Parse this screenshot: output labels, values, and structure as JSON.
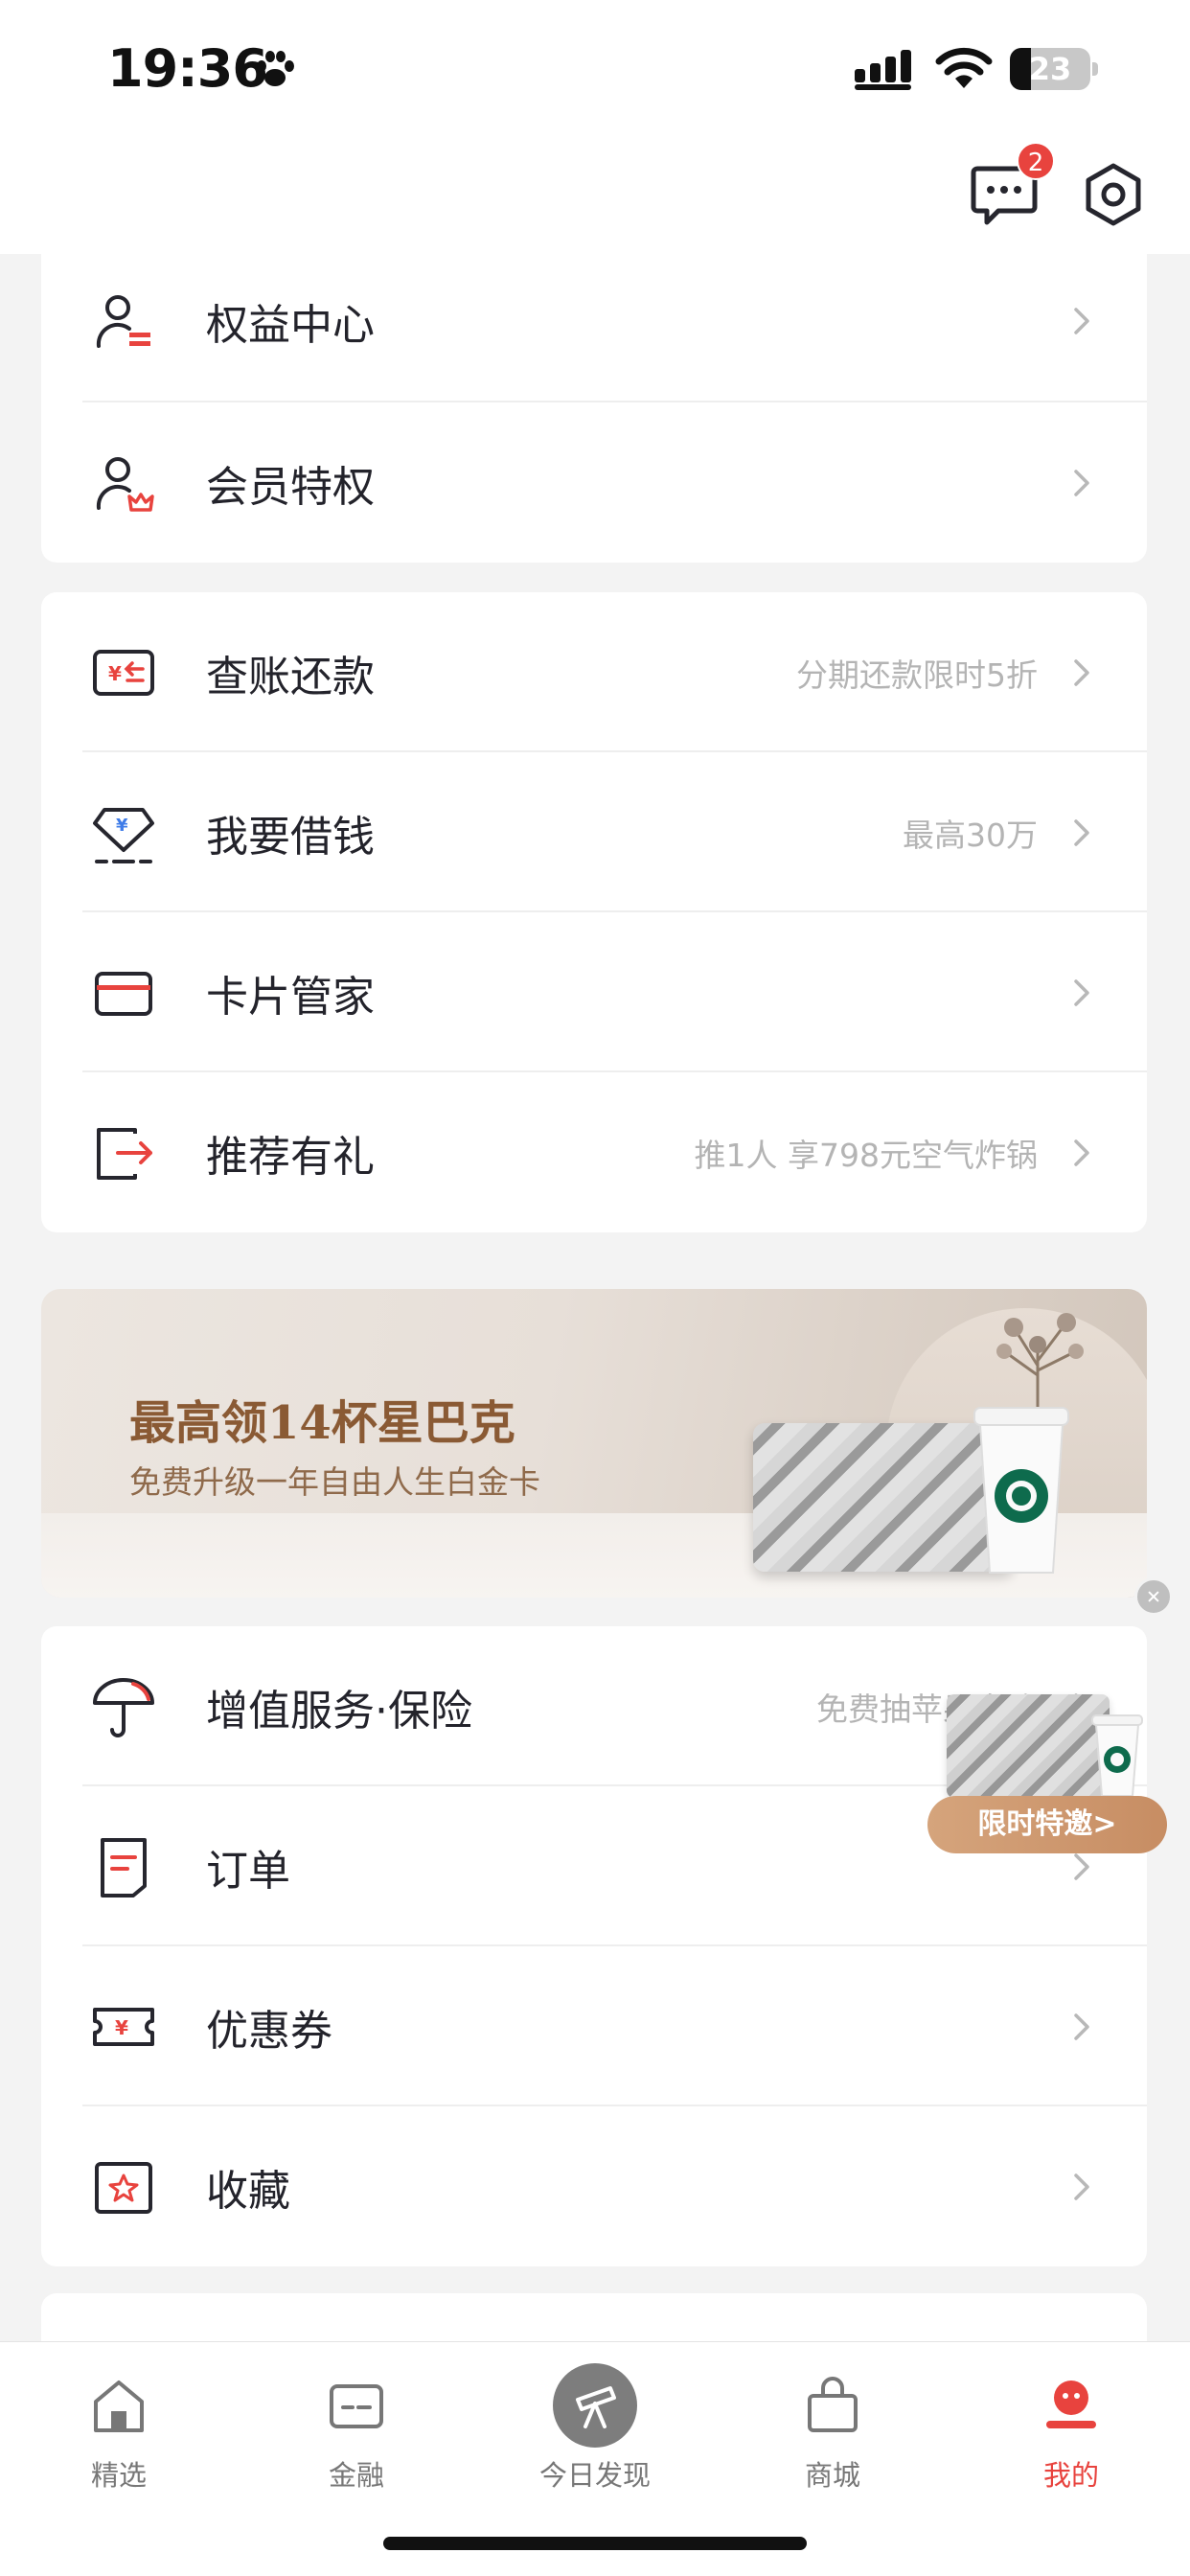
{
  "status_bar": {
    "time": "19:36",
    "battery": "23"
  },
  "header": {
    "message_badge": "2"
  },
  "card1": [
    {
      "label": "权益中心",
      "hint": "",
      "icon": "user-card-icon"
    },
    {
      "label": "会员特权",
      "hint": "",
      "icon": "user-crown-icon"
    }
  ],
  "card2": [
    {
      "label": "查账还款",
      "hint": "分期还款限时5折",
      "icon": "bill-repay-icon"
    },
    {
      "label": "我要借钱",
      "hint": "最高30万",
      "icon": "diamond-loan-icon"
    },
    {
      "label": "卡片管家",
      "hint": "",
      "icon": "card-icon"
    },
    {
      "label": "推荐有礼",
      "hint": "推1人 享798元空气炸锅",
      "icon": "share-exit-icon"
    }
  ],
  "banner": {
    "headline": "最高领14杯星巴克",
    "subline": "免费升级一年自由人生白金卡"
  },
  "card3": [
    {
      "label": "增值服务·保险",
      "hint": "免费抽苹果电脑",
      "icon": "umbrella-icon"
    },
    {
      "label": "订单",
      "hint": "",
      "icon": "order-icon"
    },
    {
      "label": "优惠券",
      "hint": "",
      "icon": "coupon-icon"
    },
    {
      "label": "收藏",
      "hint": "",
      "icon": "favorite-icon"
    }
  ],
  "float_promo": {
    "button": "限时特邀>"
  },
  "tabs": [
    {
      "label": "精选",
      "icon": "home-icon",
      "active": false
    },
    {
      "label": "金融",
      "icon": "finance-icon",
      "active": false
    },
    {
      "label": "今日发现",
      "icon": "telescope-icon",
      "active": false
    },
    {
      "label": "商城",
      "icon": "shopping-bag-icon",
      "active": false
    },
    {
      "label": "我的",
      "icon": "profile-icon",
      "active": true
    }
  ],
  "colors": {
    "accent": "#e8433e",
    "text": "#23232b",
    "hint": "#b4b4b4",
    "background": "#f3f3f3"
  }
}
